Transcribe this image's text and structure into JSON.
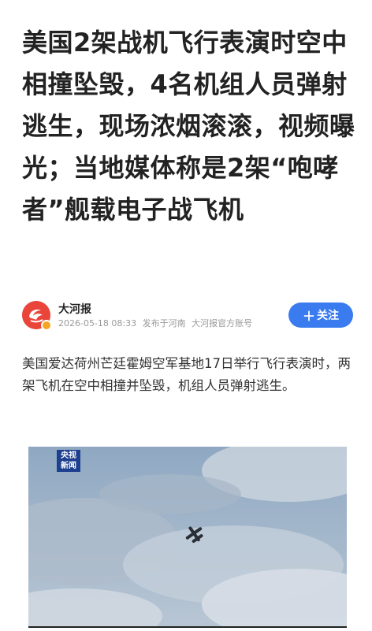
{
  "article": {
    "title": "美国2架战机飞行表演时空中相撞坠毁，4名机组人员弹射逃生，现场浓烟滚滚，视频曝光；当地媒体称是2架“咆哮者”舰载电子战飞机",
    "body": "美国爱达荷州芒廷霍姆空军基地17日举行飞行表演时，两架飞机在空中相撞并坠毁，机组人员弹射逃生。"
  },
  "author": {
    "name": "大河报",
    "datetime": "2026-05-18 08:33",
    "location": "发布于河南",
    "account_type": "大河报官方账号",
    "avatar_icon": "dahebao-logo-icon",
    "verified_icon": "verified-badge-icon"
  },
  "follow_button": {
    "icon": "plus-icon",
    "plus": "＋",
    "label": "关注",
    "color": "#3a7cf0"
  },
  "video": {
    "logo_line1": "央视",
    "logo_line2": "新闻",
    "logo_color": "#1d3f8f"
  }
}
